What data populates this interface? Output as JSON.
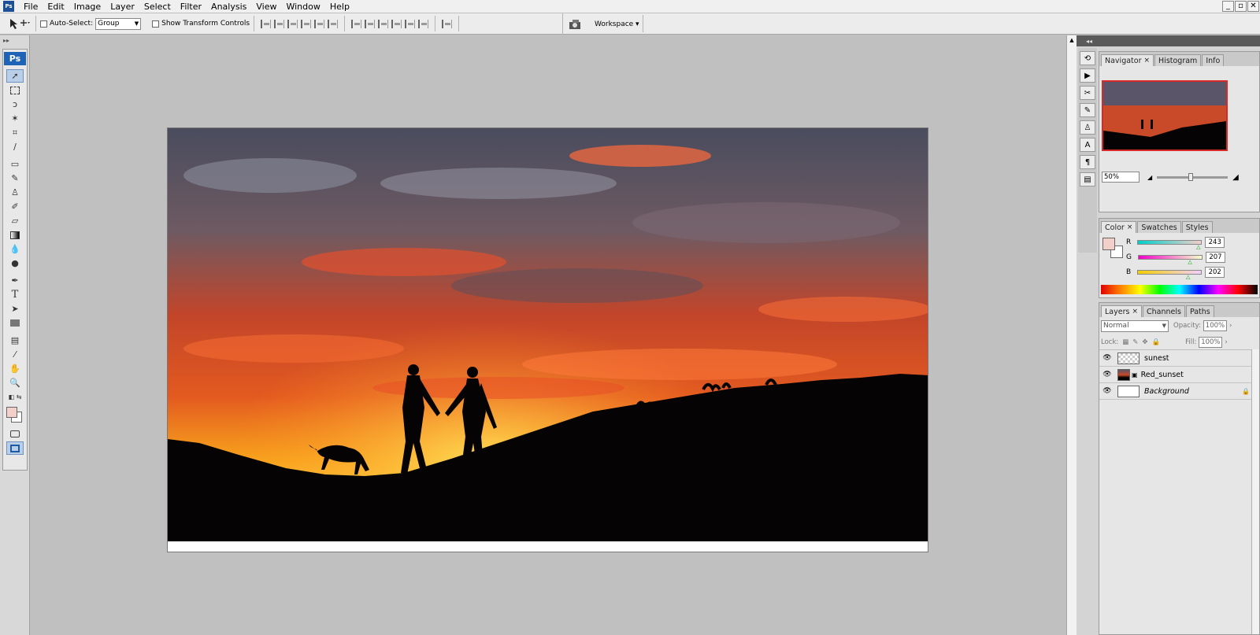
{
  "app": {
    "icon_text": "Ps",
    "logo_text": "Ps"
  },
  "menu": [
    "File",
    "Edit",
    "Image",
    "Layer",
    "Select",
    "Filter",
    "Analysis",
    "View",
    "Window",
    "Help"
  ],
  "window_controls": {
    "minimize": "_",
    "restore": "▫",
    "close": "✕"
  },
  "options": {
    "auto_select_label": "Auto-Select:",
    "auto_select_value": "Group",
    "show_transform_label": "Show Transform Controls",
    "workspace_label": "Workspace ▾"
  },
  "navigator": {
    "tabs": [
      "Navigator",
      "Histogram",
      "Info"
    ],
    "zoom": "50%"
  },
  "color_panel": {
    "tabs": [
      "Color",
      "Swatches",
      "Styles"
    ],
    "channels": [
      {
        "label": "R",
        "value": "243",
        "fraction": 0.95
      },
      {
        "label": "G",
        "value": "207",
        "fraction": 0.81
      },
      {
        "label": "B",
        "value": "202",
        "fraction": 0.79
      }
    ],
    "foreground": "#f3cfca",
    "background": "#ffffff"
  },
  "layers_panel": {
    "tabs": [
      "Layers",
      "Channels",
      "Paths"
    ],
    "blend_mode": "Normal",
    "opacity_label": "Opacity:",
    "opacity_value": "100%",
    "lock_label": "Lock:",
    "fill_label": "Fill:",
    "fill_value": "100%",
    "layers": [
      {
        "name": "sunest",
        "thumb": "checker"
      },
      {
        "name": "Red_sunset",
        "thumb": "sunset"
      },
      {
        "name": "Background",
        "thumb": "white"
      }
    ]
  }
}
